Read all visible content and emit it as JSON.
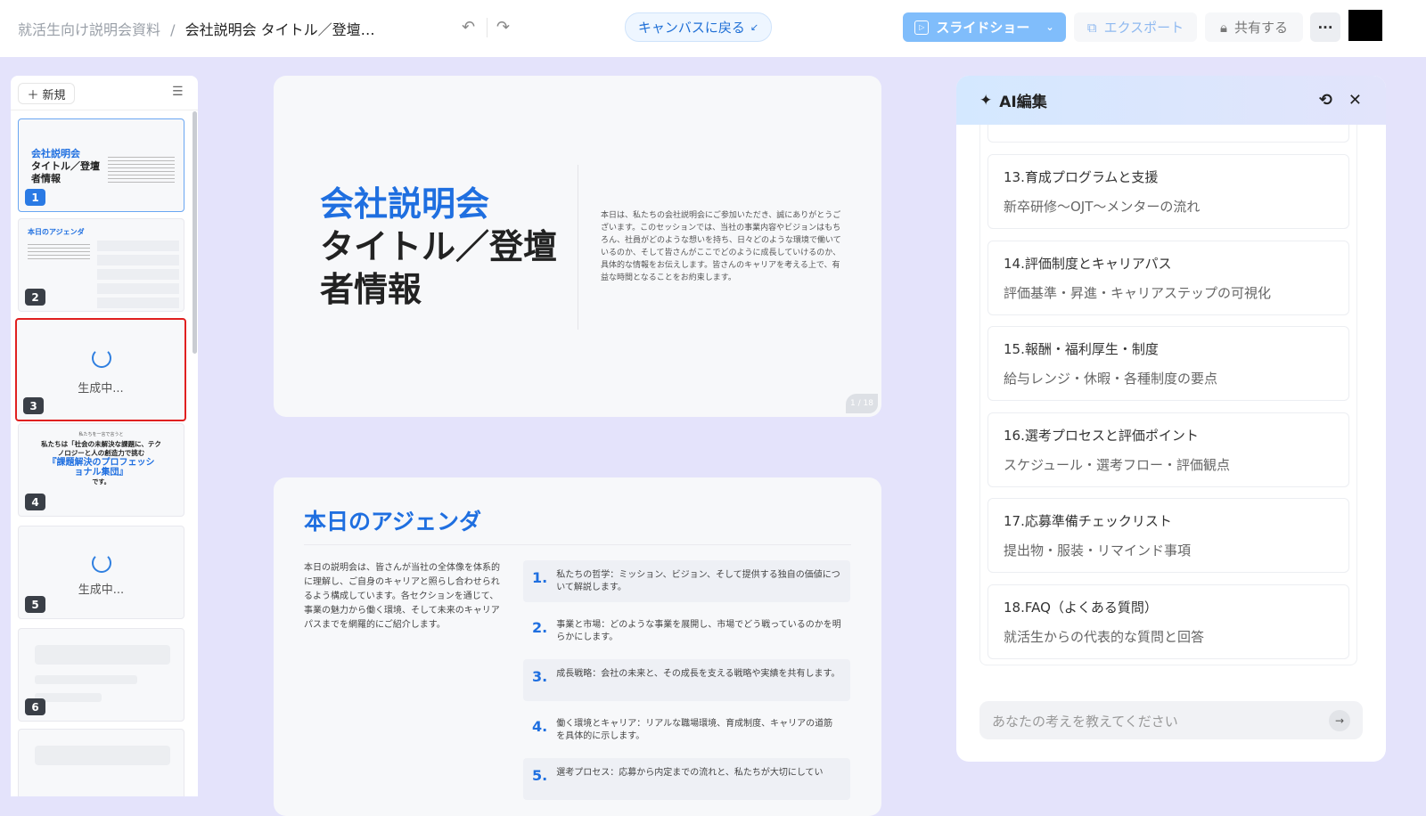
{
  "header": {
    "breadcrumb_parent": "就活生向け説明会資料",
    "breadcrumb_sep": "/",
    "breadcrumb_current": "会社説明会 タイトル／登壇…",
    "back_to_canvas": "キャンバスに戻る",
    "slideshow": "スライドショー",
    "export": "エクスポート",
    "share": "共有する",
    "more": "···"
  },
  "sidebar": {
    "new_label": "新規",
    "generating": "生成中...",
    "thumbs": [
      {
        "num": "1",
        "title_blue": "会社説明会",
        "title_rest": "タイトル／登壇者情報"
      },
      {
        "num": "2",
        "title": "本日のアジェンダ"
      },
      {
        "num": "3",
        "status": "生成中..."
      },
      {
        "num": "4",
        "lead": "私たちを一言で言うと",
        "line1": "私たちは「社会の未解決な課題に、テクノロジーと人の創造力で挑む",
        "highlight": "『課題解決のプロフェッショナル集団』",
        "end": "です。"
      },
      {
        "num": "5",
        "status": "生成中..."
      },
      {
        "num": "6"
      }
    ]
  },
  "slide1": {
    "title_blue": "会社説明会",
    "title_line2": "タイトル／登壇",
    "title_line3": "者情報",
    "body": "本日は、私たちの会社説明会にご参加いただき、誠にありがとうございます。このセッションでは、当社の事業内容やビジョンはもちろん、社員がどのような想いを持ち、日々どのような環境で働いているのか、そして皆さんがここでどのように成長していけるのか、具体的な情報をお伝えします。皆さんのキャリアを考える上で、有益な時間となることをお約束します。",
    "page": "1 / 18"
  },
  "slide2": {
    "title": "本日のアジェンダ",
    "intro": "本日の説明会は、皆さんが当社の全体像を体系的に理解し、ご自身のキャリアと照らし合わせられるよう構成しています。各セクションを通じて、事業の魅力から働く環境、そして未来のキャリアパスまでを網羅的にご紹介します。",
    "items": [
      {
        "n": "1.",
        "text": "私たちの哲学：ミッション、ビジョン、そして提供する独自の価値について解説します。"
      },
      {
        "n": "2.",
        "text": "事業と市場：どのような事業を展開し、市場でどう戦っているのかを明らかにします。"
      },
      {
        "n": "3.",
        "text": "成長戦略：会社の未来と、その成長を支える戦略や実績を共有します。"
      },
      {
        "n": "4.",
        "text": "働く環境とキャリア：リアルな職場環境、育成制度、キャリアの道筋を具体的に示します。"
      },
      {
        "n": "5.",
        "text": "選考プロセス：応募から内定までの流れと、私たちが大切にしてい"
      }
    ]
  },
  "ai_panel": {
    "title": "AI編集",
    "placeholder": "あなたの考えを教えてください",
    "items": [
      {
        "title": "13.育成プログラムと支援",
        "desc": "新卒研修〜OJT〜メンターの流れ"
      },
      {
        "title": "14.評価制度とキャリアパス",
        "desc": "評価基準・昇進・キャリアステップの可視化"
      },
      {
        "title": "15.報酬・福利厚生・制度",
        "desc": "給与レンジ・休暇・各種制度の要点"
      },
      {
        "title": "16.選考プロセスと評価ポイント",
        "desc": "スケジュール・選考フロー・評価観点"
      },
      {
        "title": "17.応募準備チェックリスト",
        "desc": "提出物・服装・リマインド事項"
      },
      {
        "title": "18.FAQ（よくある質問）",
        "desc": "就活生からの代表的な質問と回答"
      }
    ]
  },
  "colors": {
    "accent": "#1f6fe0",
    "selected_border": "#e02020",
    "background": "#e4e3fb"
  }
}
